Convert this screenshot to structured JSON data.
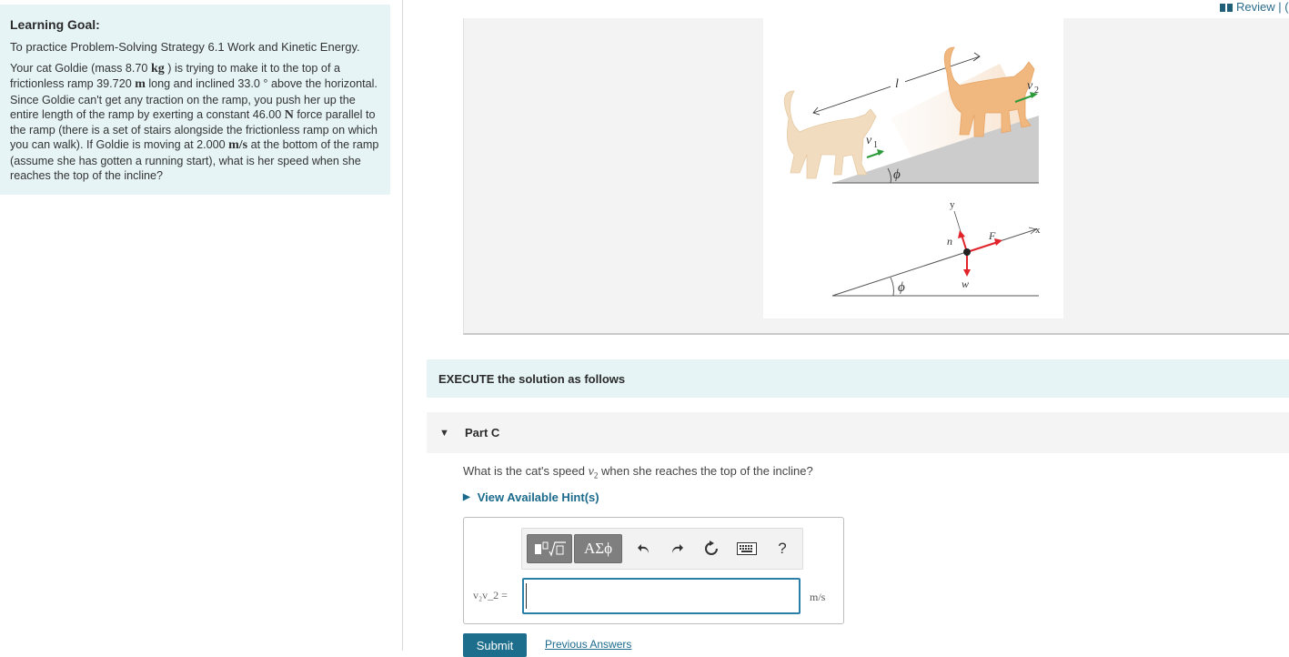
{
  "review": {
    "label": "Review | ("
  },
  "learning_goal": {
    "title": "Learning Goal:",
    "line": "To practice Problem-Solving Strategy 6.1 Work and Kinetic Energy.",
    "p1": "Your cat Goldie (mass 8.70",
    "u_kg": "kg",
    "p2": ") is trying to make it to the top of a frictionless ramp 39.720",
    "u_m": "m",
    "p3": "long and inclined 33.0",
    "deg": "°",
    "p4": "above the horizontal. Since Goldie can't get any traction on the ramp, you push her up the entire length of the ramp by exerting a constant 46.00",
    "u_n": "N",
    "p5": "force parallel to the ramp (there is a set of stairs alongside the frictionless ramp on which you can walk). If Goldie is moving at 2.000",
    "u_ms": "m/s",
    "p6": "at the bottom of the ramp (assume she has gotten a running start), what is her speed when she reaches the top of the incline?"
  },
  "figure": {
    "label_l": "l",
    "label_v1": "v",
    "label_v1_sub": "1",
    "label_v2": "v",
    "label_v2_sub": "2",
    "label_phi": "ϕ",
    "label_y": "y",
    "label_x": "x",
    "label_n": "n",
    "label_F": "F",
    "label_w": "w",
    "colors": {
      "arrow_green": "#2e9a3a",
      "arrow_red": "#e0242a",
      "ramp": "#cccccc",
      "cat_light": "#f1dcc0",
      "cat_dark": "#f0b77e"
    }
  },
  "execute": {
    "label": "EXECUTE the solution as follows"
  },
  "part": {
    "caret": "▼",
    "label": "Part C"
  },
  "question": {
    "pre": "What is the cat's speed",
    "var": "v",
    "sub": "2",
    "post": "when she reaches the top of the incline?"
  },
  "hint": {
    "caret": "▶",
    "label": "View Available Hint(s)"
  },
  "toolbar": {
    "symbols_label": "ΑΣϕ",
    "help_label": "?",
    "icons": [
      "templates-icon",
      "undo-icon",
      "redo-icon",
      "reset-icon",
      "keyboard-icon",
      "help-icon"
    ]
  },
  "answer": {
    "var_label": "v₂v_2 =",
    "value": "",
    "unit": "m/s"
  },
  "buttons": {
    "submit": "Submit",
    "previous_answers": "Previous Answers"
  }
}
